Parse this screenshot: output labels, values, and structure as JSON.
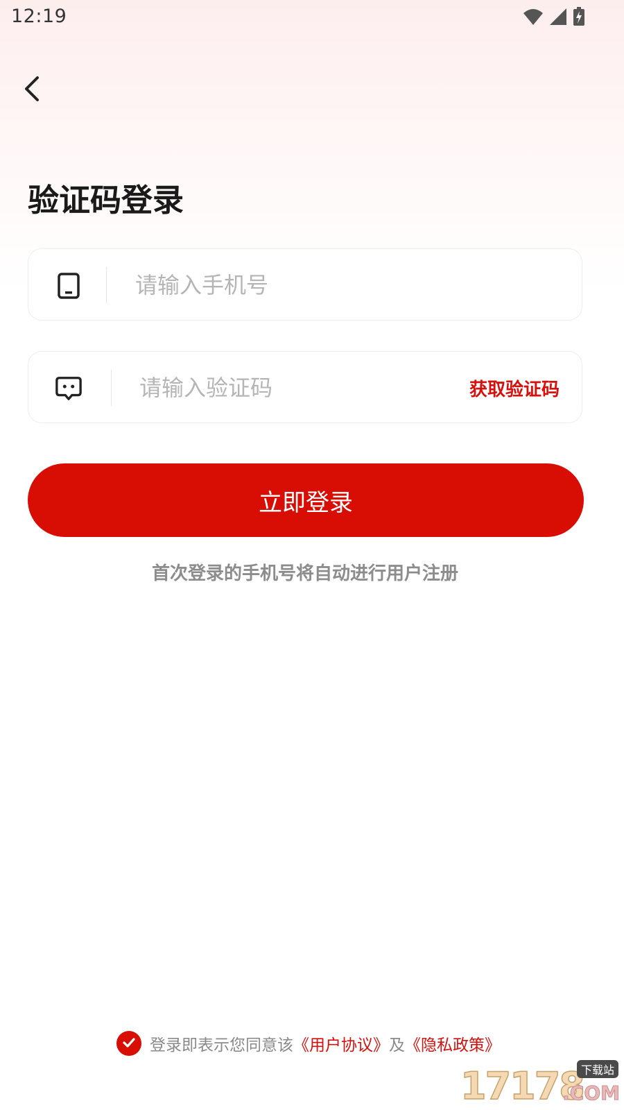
{
  "status_bar": {
    "time": "12:19"
  },
  "header": {
    "back_icon": "chevron-left-icon"
  },
  "page": {
    "title": "验证码登录"
  },
  "phone_field": {
    "icon": "phone-icon",
    "value": "",
    "placeholder": "请输入手机号"
  },
  "code_field": {
    "icon": "message-icon",
    "value": "",
    "placeholder": "请输入验证码",
    "get_code_label": "获取验证码"
  },
  "login_button": {
    "label": "立即登录"
  },
  "register_hint": "首次登录的手机号将自动进行用户注册",
  "agreement": {
    "checked": true,
    "prefix": "登录即表示您同意该",
    "user_agreement": "《用户协议》",
    "conjunction": "及",
    "privacy_policy": "《隐私政策》"
  },
  "watermark": {
    "digits": "17178",
    "domain": ".COM",
    "badge": "下载站"
  },
  "colors": {
    "accent": "#d80e05",
    "link": "#d7100d",
    "title": "#1a1a1a",
    "hint": "#8c8c8c",
    "placeholder": "#b5b5b5"
  }
}
